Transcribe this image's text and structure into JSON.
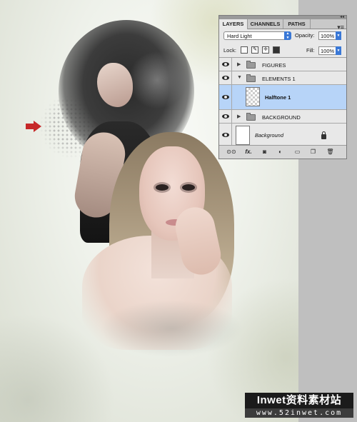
{
  "panel": {
    "tabs": [
      {
        "label": "LAYERS",
        "active": true
      },
      {
        "label": "CHANNELS",
        "active": false
      },
      {
        "label": "PATHS",
        "active": false
      }
    ],
    "blend_mode": "Hard Light",
    "opacity_label": "Opacity:",
    "opacity_value": "100%",
    "lock_label": "Lock:",
    "fill_label": "Fill:",
    "fill_value": "100%",
    "layers": [
      {
        "name": "FIGURES",
        "type": "group",
        "expanded": false,
        "visible": true
      },
      {
        "name": "ELEMENTS 1",
        "type": "group",
        "expanded": true,
        "visible": true
      },
      {
        "name": "Halftone 1",
        "type": "layer",
        "selected": true,
        "visible": true
      },
      {
        "name": "BACKGROUND",
        "type": "group",
        "expanded": false,
        "visible": true
      },
      {
        "name": "Background",
        "type": "layer",
        "locked": true,
        "visible": true
      }
    ],
    "bottom_icons": [
      "link-icon",
      "fx-icon",
      "mask-icon",
      "adjustment-icon",
      "new-group-icon",
      "new-layer-icon",
      "trash-icon"
    ],
    "bottom_glyphs": {
      "link": "⊙⊙",
      "fx": "fx.",
      "mask": "◙",
      "adjust": "◐",
      "group": "▭",
      "new": "❐",
      "trash": "🗑"
    }
  },
  "canvas": {
    "arrow_color": "#c62828"
  },
  "watermark": {
    "title": "Inwet资料素材站",
    "url": "www.52inwet.com"
  }
}
